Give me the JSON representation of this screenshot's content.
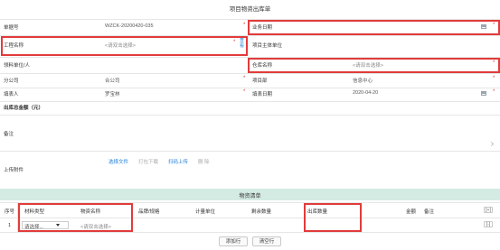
{
  "title": "项目物资出库单",
  "fields": {
    "doc_no": {
      "label": "单据号",
      "value": "WZCK-20200420-035"
    },
    "biz_date": {
      "label": "业务日期",
      "value": ""
    },
    "project": {
      "label": "工程名称",
      "placeholder": "<请双击选择>",
      "side_link": "查看"
    },
    "owner_unit": {
      "label": "项目主体单位",
      "value": ""
    },
    "receiver": {
      "label": "领料单位/人",
      "value": ""
    },
    "warehouse": {
      "label": "仓库名称",
      "placeholder": "<请双击选择>"
    },
    "branch": {
      "label": "分公司",
      "value": "合公司"
    },
    "dept": {
      "label": "项目部",
      "value": "信息中心"
    },
    "creator": {
      "label": "填表人",
      "value": "罗宝林"
    },
    "fill_date": {
      "label": "填表日期",
      "value": "2020-04-20"
    },
    "amount": {
      "label": "出库总金额（元）",
      "value": ""
    },
    "remark": {
      "label": "备注",
      "value": ""
    },
    "attachment": {
      "label": "上传附件",
      "actions": [
        "选择文件",
        "打包下载",
        "扫码上传",
        "删 除"
      ]
    }
  },
  "section_title": "物资清单",
  "table": {
    "headers": [
      "序号",
      "材料类型",
      "物资名称",
      "品牌/规格",
      "计量单位",
      "剩余数量",
      "出库数量",
      "金额",
      "备注"
    ],
    "rows": [
      {
        "index": "1",
        "type": "请选择...",
        "name": "<请双击选择>"
      }
    ],
    "header_action": "[+]",
    "row_action": "[-]"
  },
  "buttons": {
    "add_row": "添加行",
    "clear_rows": "清空行"
  },
  "colors": {
    "highlight": "#e23b3b",
    "link": "#1f7cd6",
    "section_bg": "#d4ebe3"
  }
}
